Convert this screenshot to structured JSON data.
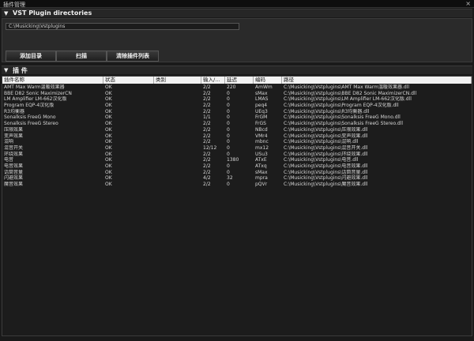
{
  "window": {
    "title": "插件管理",
    "close": "×"
  },
  "vst": {
    "header": "VST Plugin directories",
    "path": "C:\\Musicking\\Vstplugins",
    "buttons": {
      "add": "添加目录",
      "scan": "扫描",
      "clear": "清除插件列表"
    }
  },
  "plugins": {
    "header": "插 件",
    "columns": [
      "插件名称",
      "状态",
      "类别",
      "输入/...",
      "延迟",
      "编码",
      "路径"
    ],
    "rows": [
      [
        "AMT Max Warm温暖效果器",
        "OK",
        "",
        "2/2",
        "220",
        "AmWm",
        "C:\\Musicking\\Vstplugins\\AMT Max Warm温暖效果器.dll"
      ],
      [
        "BBE D82 Sonic MaximizerCN",
        "OK",
        "",
        "2/2",
        "0",
        "sMax",
        "C:\\Musicking\\Vstplugins\\BBE D82 Sonic MaximizerCN.dll"
      ],
      [
        "LM Amplifier LM-662汉化版",
        "OK",
        "",
        "2/2",
        "0",
        "LMAS",
        "C:\\Musicking\\Vstplugins\\LM Amplifier LM-662汉化版.dll"
      ],
      [
        "Program EQP-4汉化版",
        "OK",
        "",
        "2/2",
        "0",
        "peq4",
        "C:\\Musicking\\Vstplugins\\Program EQP-4汉化版.dll"
      ],
      [
        "R3均衡器",
        "OK",
        "",
        "2/2",
        "0",
        "UEq3",
        "C:\\Musicking\\Vstplugins\\R3均衡器.dll"
      ],
      [
        "Sonalksis FreeG Mono",
        "OK",
        "",
        "1/1",
        "0",
        "FrGM",
        "C:\\Musicking\\Vstplugins\\Sonalksis FreeG Mono.dll"
      ],
      [
        "Sonalksis FreeG Stereo",
        "OK",
        "",
        "2/2",
        "0",
        "FrGS",
        "C:\\Musicking\\Vstplugins\\Sonalksis FreeG Stereo.dll"
      ],
      [
        "压限效果",
        "OK",
        "",
        "2/2",
        "0",
        "NBcd",
        "C:\\Musicking\\Vstplugins\\压限效果.dll"
      ],
      [
        "变声效果",
        "OK",
        "",
        "2/2",
        "0",
        "VMr4",
        "C:\\Musicking\\Vstplugins\\变声效果.dll"
      ],
      [
        "混响",
        "OK",
        "",
        "2/2",
        "0",
        "mbnc",
        "C:\\Musicking\\Vstplugins\\混响.dll"
      ],
      [
        "混音开关",
        "OK",
        "",
        "12/12",
        "0",
        "mx12",
        "C:\\Musicking\\Vstplugins\\混音开关.dll"
      ],
      [
        "环绕效果",
        "OK",
        "",
        "2/2",
        "0",
        "USu3",
        "C:\\Musicking\\Vstplugins\\环绕效果.dll"
      ],
      [
        "电音",
        "OK",
        "",
        "2/2",
        "1380",
        "ATxE",
        "C:\\Musicking\\Vstplugins\\电音.dll"
      ],
      [
        "电音效果",
        "OK",
        "",
        "2/2",
        "0",
        "ATxq",
        "C:\\Musicking\\Vstplugins\\电音效果.dll"
      ],
      [
        "话筒音量",
        "OK",
        "",
        "2/2",
        "0",
        "sMax",
        "C:\\Musicking\\Vstplugins\\话筒音量.dll"
      ],
      [
        "闪避效果",
        "OK",
        "",
        "4/2",
        "32",
        "mpra",
        "C:\\Musicking\\Vstplugins\\闪避效果.dll"
      ],
      [
        "魔音效果",
        "OK",
        "",
        "2/2",
        "0",
        "pQVr",
        "C:\\Musicking\\Vstplugins\\魔音效果.dll"
      ]
    ]
  },
  "icons": {
    "collapse": "triangle-down-icon"
  }
}
